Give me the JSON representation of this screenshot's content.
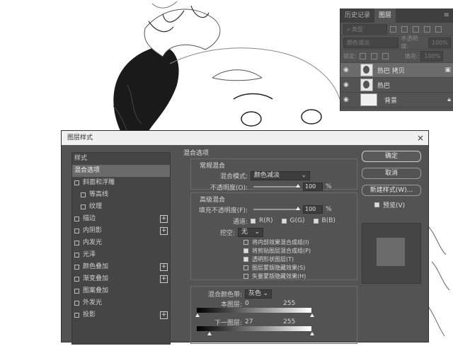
{
  "layers_panel": {
    "tabs": [
      "历史记录",
      "图层"
    ],
    "filter_label": "类型",
    "blend_mode": "颜色减淡",
    "opacity_label": "不透明度:",
    "opacity_value": "100%",
    "lock_label": "锁定:",
    "fill_label": "填充:",
    "fill_value": "100%",
    "layers": [
      {
        "name": "热巴 拷贝",
        "selected": true
      },
      {
        "name": "热巴",
        "selected": false
      },
      {
        "name": "背景",
        "selected": false
      }
    ]
  },
  "dialog": {
    "title": "图层样式",
    "styles_heading": "样式",
    "styles": [
      {
        "label": "混合选项",
        "checkbox": false,
        "active": true,
        "plus": false,
        "indent": false
      },
      {
        "label": "斜面和浮雕",
        "checkbox": true,
        "active": false,
        "plus": false,
        "indent": false
      },
      {
        "label": "等高线",
        "checkbox": true,
        "active": false,
        "plus": false,
        "indent": true
      },
      {
        "label": "纹理",
        "checkbox": true,
        "active": false,
        "plus": false,
        "indent": true
      },
      {
        "label": "描边",
        "checkbox": true,
        "active": false,
        "plus": true,
        "indent": false
      },
      {
        "label": "内阴影",
        "checkbox": true,
        "active": false,
        "plus": true,
        "indent": false
      },
      {
        "label": "内发光",
        "checkbox": true,
        "active": false,
        "plus": false,
        "indent": false
      },
      {
        "label": "光泽",
        "checkbox": true,
        "active": false,
        "plus": false,
        "indent": false
      },
      {
        "label": "颜色叠加",
        "checkbox": true,
        "active": false,
        "plus": true,
        "indent": false
      },
      {
        "label": "渐变叠加",
        "checkbox": true,
        "active": false,
        "plus": true,
        "indent": false
      },
      {
        "label": "图案叠加",
        "checkbox": true,
        "active": false,
        "plus": false,
        "indent": false
      },
      {
        "label": "外发光",
        "checkbox": true,
        "active": false,
        "plus": false,
        "indent": false
      },
      {
        "label": "投影",
        "checkbox": true,
        "active": false,
        "plus": true,
        "indent": false
      }
    ],
    "blending": {
      "section_title": "混合选项",
      "general_title": "常规混合",
      "blend_mode_label": "混合模式:",
      "blend_mode_value": "颜色减淡",
      "opacity_label": "不透明度(O):",
      "opacity_value": "100",
      "pct": "%",
      "advanced_title": "高级混合",
      "fill_opacity_label": "填充不透明度(F):",
      "fill_opacity_value": "100",
      "channels_label": "通道:",
      "channel_r": "R(R)",
      "channel_g": "G(G)",
      "channel_b": "B(B)",
      "knockout_label": "挖空:",
      "knockout_value": "无",
      "options": [
        {
          "label": "将内部效果混合成组(I)",
          "checked": false
        },
        {
          "label": "将剪贴图层混合成组(P)",
          "checked": true
        },
        {
          "label": "透明形状图层(T)",
          "checked": true
        },
        {
          "label": "图层蒙版隐藏效果(S)",
          "checked": false
        },
        {
          "label": "矢量蒙版隐藏效果(H)",
          "checked": false
        }
      ],
      "blend_if_label": "混合颜色带:",
      "blend_if_value": "灰色",
      "this_layer_label": "本图层:",
      "this_layer_low": "0",
      "this_layer_high": "255",
      "under_layer_label": "下一图层:",
      "under_layer_low": "27",
      "under_layer_high": "255"
    },
    "buttons": {
      "ok": "确定",
      "cancel": "取消",
      "new_style": "新建样式(W)...",
      "preview_label": "预览(V)"
    }
  }
}
